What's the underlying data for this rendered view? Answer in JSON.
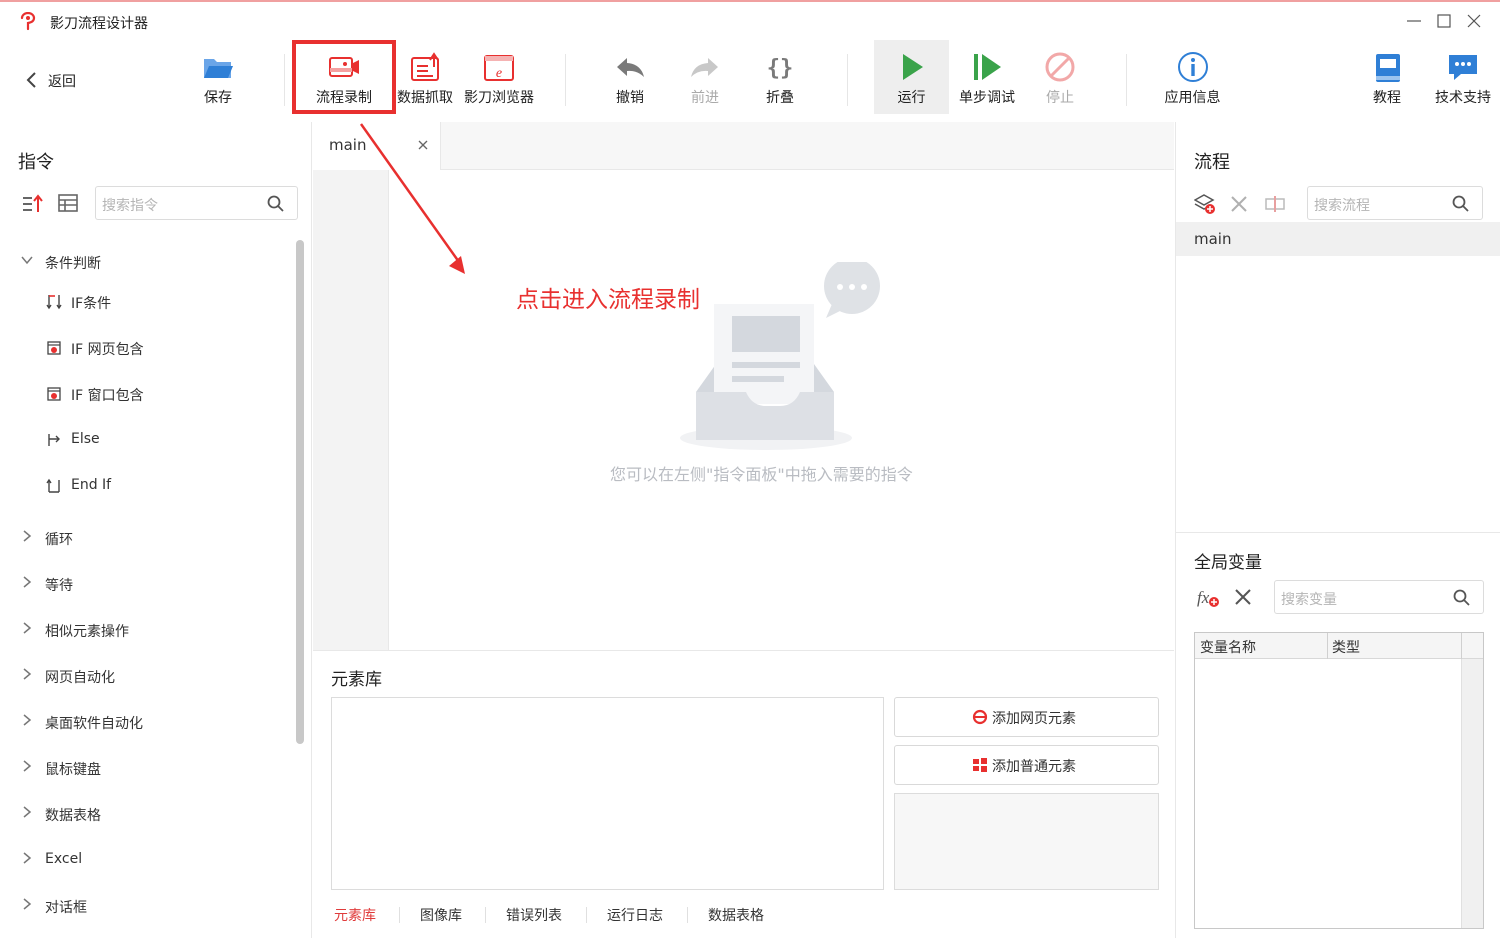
{
  "app": {
    "title": "影刀流程设计器"
  },
  "toolbar": {
    "back": "返回",
    "save": "保存",
    "record": "流程录制",
    "scrape": "数据抓取",
    "browser": "影刀浏览器",
    "undo": "撤销",
    "redo": "前进",
    "fold": "折叠",
    "run": "运行",
    "step": "单步调试",
    "stop": "停止",
    "appinfo": "应用信息",
    "tutorial": "教程",
    "support": "技术支持"
  },
  "commands": {
    "title": "指令",
    "search_placeholder": "搜索指令",
    "groups": [
      {
        "label": "条件判断",
        "expanded": true,
        "children": [
          "IF条件",
          "IF 网页包含",
          "IF 窗口包含",
          "Else",
          "End If"
        ]
      },
      {
        "label": "循环"
      },
      {
        "label": "等待"
      },
      {
        "label": "相似元素操作"
      },
      {
        "label": "网页自动化"
      },
      {
        "label": "桌面软件自动化"
      },
      {
        "label": "鼠标键盘"
      },
      {
        "label": "数据表格"
      },
      {
        "label": "Excel"
      },
      {
        "label": "对话框"
      }
    ]
  },
  "editor": {
    "tab": "main",
    "annotation": "点击进入流程录制",
    "empty_hint": "您可以在左侧\"指令面板\"中拖入需要的指令"
  },
  "elements": {
    "title": "元素库",
    "add_web": "添加网页元素",
    "add_normal": "添加普通元素",
    "tabs": [
      "元素库",
      "图像库",
      "错误列表",
      "运行日志",
      "数据表格"
    ]
  },
  "flows": {
    "title": "流程",
    "search_placeholder": "搜索流程",
    "items": [
      "main"
    ]
  },
  "globals": {
    "title": "全局变量",
    "search_placeholder": "搜索变量",
    "columns": [
      "变量名称",
      "类型"
    ]
  },
  "colors": {
    "accent_red": "#e8302f",
    "run_green": "#3aa34a",
    "icon_blue": "#2f7fd6"
  }
}
